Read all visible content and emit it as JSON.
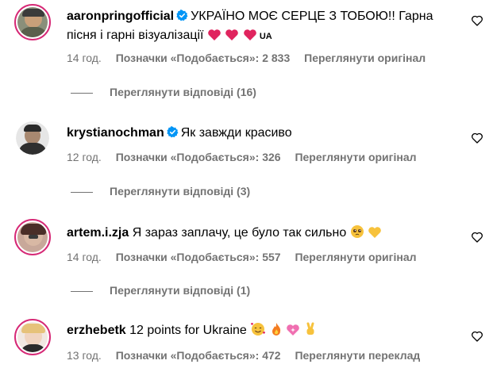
{
  "comments": [
    {
      "username": "aaronpringofficial",
      "verified": true,
      "text_line1": "УКРАЇНО МОЄ СЕРЦЕ З ТОБОЮ!! Гарна",
      "text_line2": "пісня і гарні візуалізації",
      "flag_text": "UA",
      "time": "14 год.",
      "likes": "Позначки «Подобається»: 2 833",
      "action": "Переглянути оригінал",
      "replies": "Переглянути відповіді (16)"
    },
    {
      "username": "krystianochman",
      "verified": true,
      "text": "Як завжди красиво",
      "time": "12 год.",
      "likes": "Позначки «Подобається»: 326",
      "action": "Переглянути оригінал",
      "replies": "Переглянути відповіді (3)"
    },
    {
      "username": "artem.i.zja",
      "verified": false,
      "text": "Я зараз заплачу, це було так сильно",
      "time": "14 год.",
      "likes": "Позначки «Подобається»: 557",
      "action": "Переглянути оригінал",
      "replies": "Переглянути відповіді (1)"
    },
    {
      "username": "erzhebetk",
      "verified": false,
      "text": "12 points for Ukraine",
      "time": "13 год.",
      "likes": "Позначки «Подобається»: 472",
      "action": "Переглянути переклад"
    }
  ],
  "colors": {
    "verified": "#0095f6",
    "secondary_text": "#737373",
    "story_ring": "#d62976",
    "heart_red": "#e0245e"
  }
}
